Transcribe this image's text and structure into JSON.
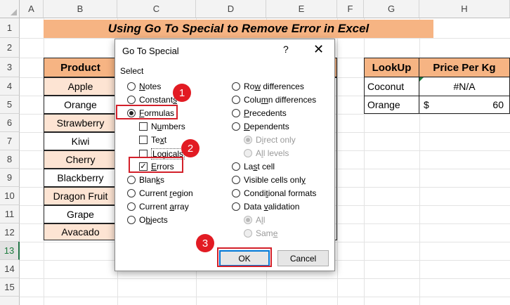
{
  "columns": [
    "A",
    "B",
    "C",
    "D",
    "E",
    "F",
    "G",
    "H"
  ],
  "rows": [
    "1",
    "2",
    "3",
    "4",
    "5",
    "6",
    "7",
    "8",
    "9",
    "10",
    "11",
    "12",
    "13",
    "14",
    "15"
  ],
  "selected_row": "13",
  "title": "Using Go To Special to Remove Error in Excel",
  "product_table": {
    "header": "Product",
    "items": [
      "Apple",
      "Orange",
      "Strawberry",
      "Kiwi",
      "Cherry",
      "Blackberry",
      "Dragon Fruit",
      "Grape",
      "Avacado"
    ]
  },
  "lookup_table": {
    "headers": [
      "LookUp",
      "Price Per Kg"
    ],
    "row1": {
      "lookup": "Coconut",
      "price": "#N/A"
    },
    "row2": {
      "lookup": "Orange",
      "currency": "$",
      "price": "60"
    }
  },
  "dialog": {
    "title": "Go To Special",
    "help": "?",
    "close": "✕",
    "select_label": "Select",
    "left_options": {
      "notes": {
        "pre": "",
        "key": "N",
        "rest": "otes"
      },
      "constants": {
        "pre": "Constant",
        "key": "s",
        "rest": ""
      },
      "formulas": {
        "pre": "",
        "key": "F",
        "rest": "ormulas"
      },
      "numbers": {
        "pre": "N",
        "key": "u",
        "rest": "mbers"
      },
      "text": {
        "pre": "Te",
        "key": "x",
        "rest": "t"
      },
      "logicals": {
        "pre": "",
        "key": "L",
        "rest": "ogicals"
      },
      "errors": {
        "pre": "",
        "key": "E",
        "rest": "rrors"
      },
      "blanks": {
        "pre": "Blan",
        "key": "k",
        "rest": "s"
      },
      "current_region": {
        "pre": "Current ",
        "key": "r",
        "rest": "egion"
      },
      "current_array": {
        "pre": "Current ",
        "key": "a",
        "rest": "rray"
      },
      "objects": {
        "pre": "O",
        "key": "b",
        "rest": "jects"
      }
    },
    "right_options": {
      "row_diff": {
        "pre": "Ro",
        "key": "w",
        "rest": " differences"
      },
      "col_diff": {
        "pre": "Colu",
        "key": "m",
        "rest": "n differences"
      },
      "precedents": {
        "pre": "",
        "key": "P",
        "rest": "recedents"
      },
      "dependents": {
        "pre": "",
        "key": "D",
        "rest": "ependents"
      },
      "direct_only": {
        "pre": "D",
        "key": "i",
        "rest": "rect only"
      },
      "all_levels": {
        "pre": "A",
        "key": "l",
        "rest": "l levels"
      },
      "last_cell": {
        "pre": "La",
        "key": "s",
        "rest": "t cell"
      },
      "visible_cells": {
        "pre": "Visible cells onl",
        "key": "y",
        "rest": ""
      },
      "conditional": {
        "pre": "Condi",
        "key": "t",
        "rest": "ional formats"
      },
      "data_validation": {
        "pre": "Data ",
        "key": "v",
        "rest": "alidation"
      },
      "dv_all": {
        "pre": "A",
        "key": "l",
        "rest": "l"
      },
      "dv_same": {
        "pre": "Sam",
        "key": "e",
        "rest": ""
      }
    },
    "ok_label": "OK",
    "cancel_label": "Cancel"
  },
  "annotations": [
    "1",
    "2",
    "3"
  ],
  "colors": {
    "title_bg": "#f6b483",
    "header_bg": "#f6b483",
    "alt_row": "#fde4d3",
    "marker_red": "#e21b23"
  }
}
